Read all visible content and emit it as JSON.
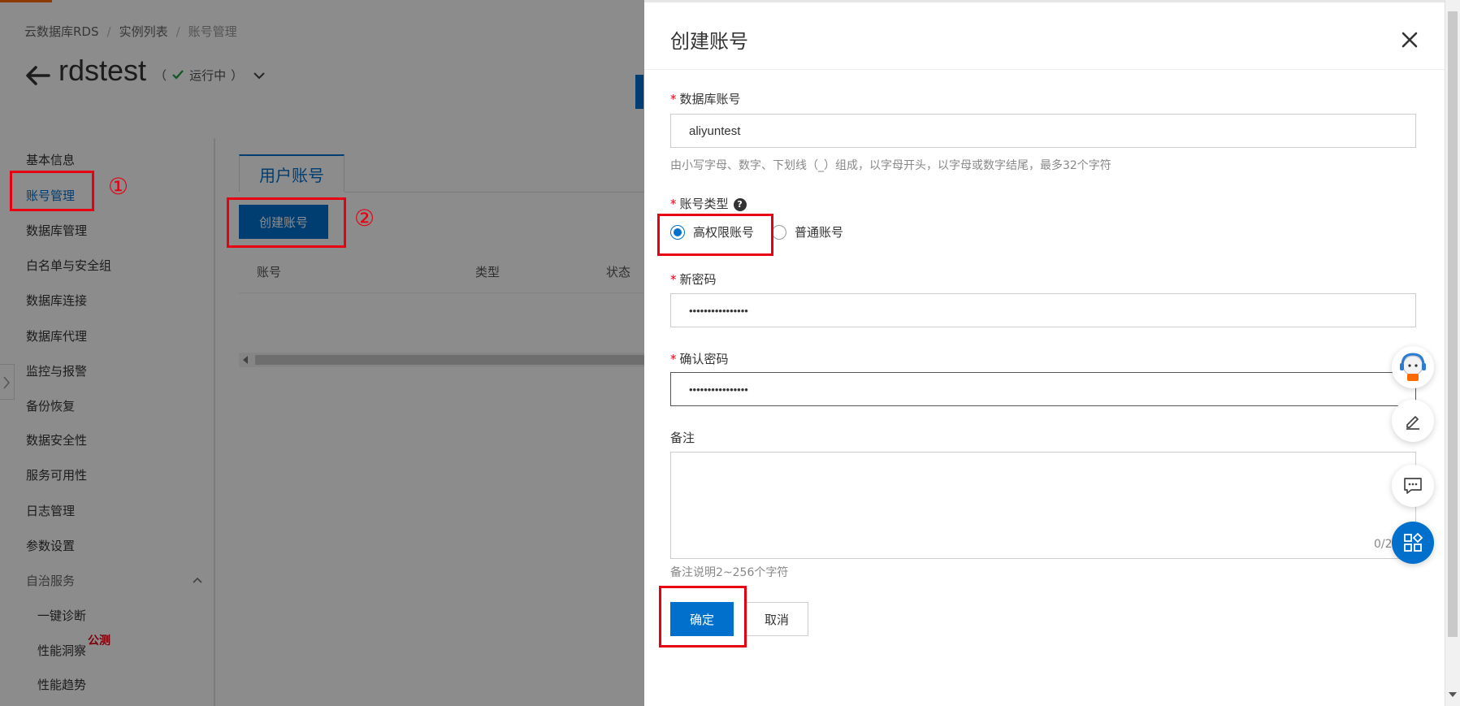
{
  "breadcrumb": {
    "item1": "云数据库RDS",
    "sep": "/",
    "item2": "实例列表",
    "item3": "账号管理"
  },
  "instance": {
    "name": "rdstest",
    "status_open": "（",
    "status": "运行中",
    "status_close": "）"
  },
  "sidebar": {
    "items": [
      "基本信息",
      "账号管理",
      "数据库管理",
      "白名单与安全组",
      "数据库连接",
      "数据库代理",
      "监控与报警",
      "备份恢复",
      "数据安全性",
      "服务可用性",
      "日志管理",
      "参数设置",
      "自治服务"
    ],
    "sub_items": [
      "一键诊断",
      "性能洞察",
      "性能趋势"
    ],
    "beta_tag": "公测"
  },
  "main": {
    "tab_label": "用户账号",
    "create_button": "创建账号",
    "columns": [
      "账号",
      "类型",
      "状态"
    ]
  },
  "annotations": {
    "step1": "①",
    "step2": "②"
  },
  "drawer": {
    "title": "创建账号",
    "required_mark": "*",
    "db_account_label": "数据库账号",
    "db_account_value": "aliyuntest",
    "db_account_help": "由小写字母、数字、下划线（_）组成，以字母开头，以字母或数字结尾，最多32个字符",
    "account_type_label": "账号类型",
    "help_mark": "?",
    "account_types": [
      "高权限账号",
      "普通账号"
    ],
    "selected_type": "高权限账号",
    "new_password_label": "新密码",
    "new_password_value": "••••••••••••••••",
    "confirm_password_label": "确认密码",
    "confirm_password_value": "••••••••••••••••",
    "remark_label": "备注",
    "remark_counter": "0/2",
    "remark_help": "备注说明2~256个字符",
    "ok_button": "确定",
    "cancel_button": "取消"
  },
  "colors": {
    "accent": "#0070cc",
    "annotation_red": "#e60012",
    "brand_orange": "#ff6a00"
  },
  "icons": [
    "back-arrow-icon",
    "check-icon",
    "chevron-down-icon",
    "chevron-up-icon",
    "close-icon",
    "help-icon",
    "assistant-avatar-icon",
    "edit-icon",
    "chat-icon",
    "apps-icon"
  ]
}
